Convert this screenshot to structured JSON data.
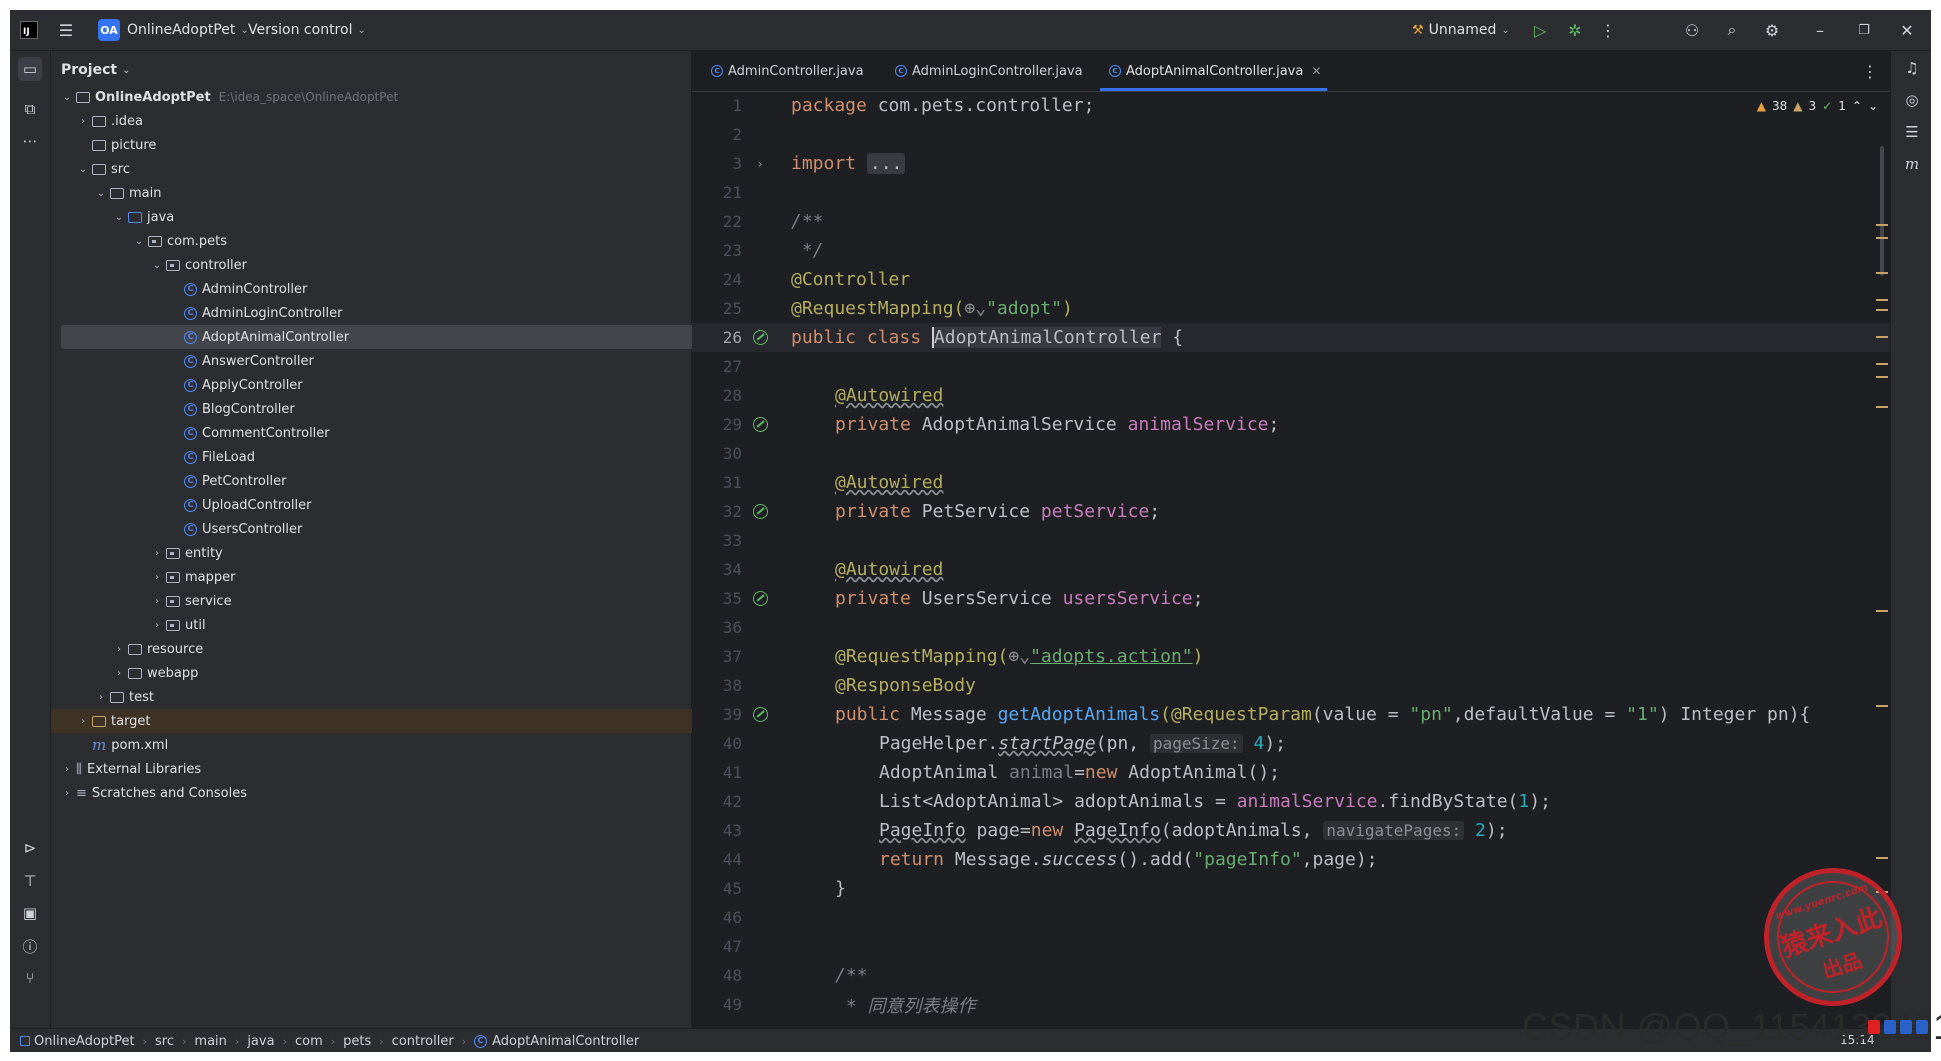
{
  "titlebar": {
    "project_badge": "OA",
    "project_name": "OnlineAdoptPet",
    "vcs": "Version control",
    "run_config": "Unnamed"
  },
  "project_panel": {
    "header": "Project",
    "root": {
      "name": "OnlineAdoptPet",
      "path": "E:\\idea_space\\OnlineAdoptPet"
    },
    "tree": [
      {
        "label": ".idea"
      },
      {
        "label": "picture"
      },
      {
        "label": "src"
      },
      {
        "label": "main"
      },
      {
        "label": "java"
      },
      {
        "label": "com.pets"
      },
      {
        "label": "controller"
      },
      {
        "label": "AdminController"
      },
      {
        "label": "AdminLoginController"
      },
      {
        "label": "AdoptAnimalController"
      },
      {
        "label": "AnswerController"
      },
      {
        "label": "ApplyController"
      },
      {
        "label": "BlogController"
      },
      {
        "label": "CommentController"
      },
      {
        "label": "FileLoad"
      },
      {
        "label": "PetController"
      },
      {
        "label": "UploadController"
      },
      {
        "label": "UsersController"
      },
      {
        "label": "entity"
      },
      {
        "label": "mapper"
      },
      {
        "label": "service"
      },
      {
        "label": "util"
      },
      {
        "label": "resource"
      },
      {
        "label": "webapp"
      },
      {
        "label": "test"
      },
      {
        "label": "target"
      },
      {
        "label": "pom.xml"
      },
      {
        "label": "External Libraries"
      },
      {
        "label": "Scratches and Consoles"
      }
    ]
  },
  "tabs": [
    {
      "label": "AdminController.java"
    },
    {
      "label": "AdminLoginController.java"
    },
    {
      "label": "AdoptAnimalController.java",
      "active": true
    }
  ],
  "inspections": {
    "warnings": "38",
    "weak_warnings": "3",
    "ok": "1"
  },
  "line_numbers": [
    "1",
    "2",
    "3",
    "21",
    "22",
    "23",
    "24",
    "25",
    "26",
    "27",
    "28",
    "29",
    "30",
    "31",
    "32",
    "33",
    "34",
    "35",
    "36",
    "37",
    "38",
    "39",
    "40",
    "41",
    "42",
    "43",
    "44",
    "45",
    "46",
    "47",
    "48",
    "49"
  ],
  "code": {
    "package_kw": "package",
    "package_name": " com.pets.controller;",
    "import_kw": "import",
    "import_dots": "...",
    "c22": "/**",
    "c23": " */",
    "a24": "@Controller",
    "a25": "@RequestMapping(",
    "globe": "⊕⌄",
    "s25": "\"adopt\"",
    "p25": ")",
    "kw26": "public class ",
    "cls26": "AdoptAnimalController",
    "b26": " {",
    "autowired": "@Autowired",
    "private_kw": "private ",
    "t29": "AdoptAnimalService ",
    "f29": "animalService",
    "t32": "PetService ",
    "f32": "petService",
    "t35": "UsersService ",
    "f35": "usersService",
    "semi": ";",
    "a37": "@RequestMapping(",
    "s37": "\"adopts.action\"",
    "p37": ")",
    "a38": "@ResponseBody",
    "kw39": "public ",
    "t39": "Message ",
    "m39": "getAdoptAnimals",
    "a39": "(@RequestParam",
    "p39a": "(value = ",
    "s39a": "\"pn\"",
    "p39b": ",defaultValue = ",
    "s39b": "\"1\"",
    "p39c": ") Integer pn){",
    "t40": "PageHelper.",
    "m40": "startPage",
    "p40": "(pn, ",
    "h40": "pageSize:",
    "n40": " 4",
    "e40": ");",
    "t41": "AdoptAnimal ",
    "v41": "animal",
    "p41": "=",
    "kw41": "new ",
    "e41": "AdoptAnimal();",
    "t42": "List<AdoptAnimal> adoptAnimals = ",
    "f42": "animalService",
    "p42": ".findByState(",
    "n42": "1",
    "e42": ");",
    "t43a": "PageInfo",
    "t43b": " page=",
    "kw43": "new ",
    "t43c": "PageInfo",
    "p43": "(adoptAnimals, ",
    "h43": "navigatePages:",
    "n43": " 2",
    "e43": ");",
    "kw44": "return ",
    "t44a": "Message.",
    "m44": "success",
    "t44b": "().add(",
    "s44": "\"pageInfo\"",
    "e44": ",page);",
    "b45": "}",
    "c48": "/**",
    "c49": " * 同意列表操作"
  },
  "breadcrumbs": [
    "OnlineAdoptPet",
    "src",
    "main",
    "java",
    "com",
    "pets",
    "controller",
    "AdoptAnimalController"
  ],
  "watermark": {
    "url": "www.yuenrc.com",
    "line1": "猿来入此",
    "line2": "出品",
    "csdn": "CSDN @QQ_1154133031"
  },
  "clock": "15:14",
  "colors": {
    "accent": "#3574f0",
    "keyword": "#cf8e6d",
    "annotation": "#b3ae60",
    "string": "#6aab73",
    "field": "#c77dbb",
    "method": "#56a8f5",
    "number": "#2aacb8",
    "stamp": "#c0222a"
  }
}
